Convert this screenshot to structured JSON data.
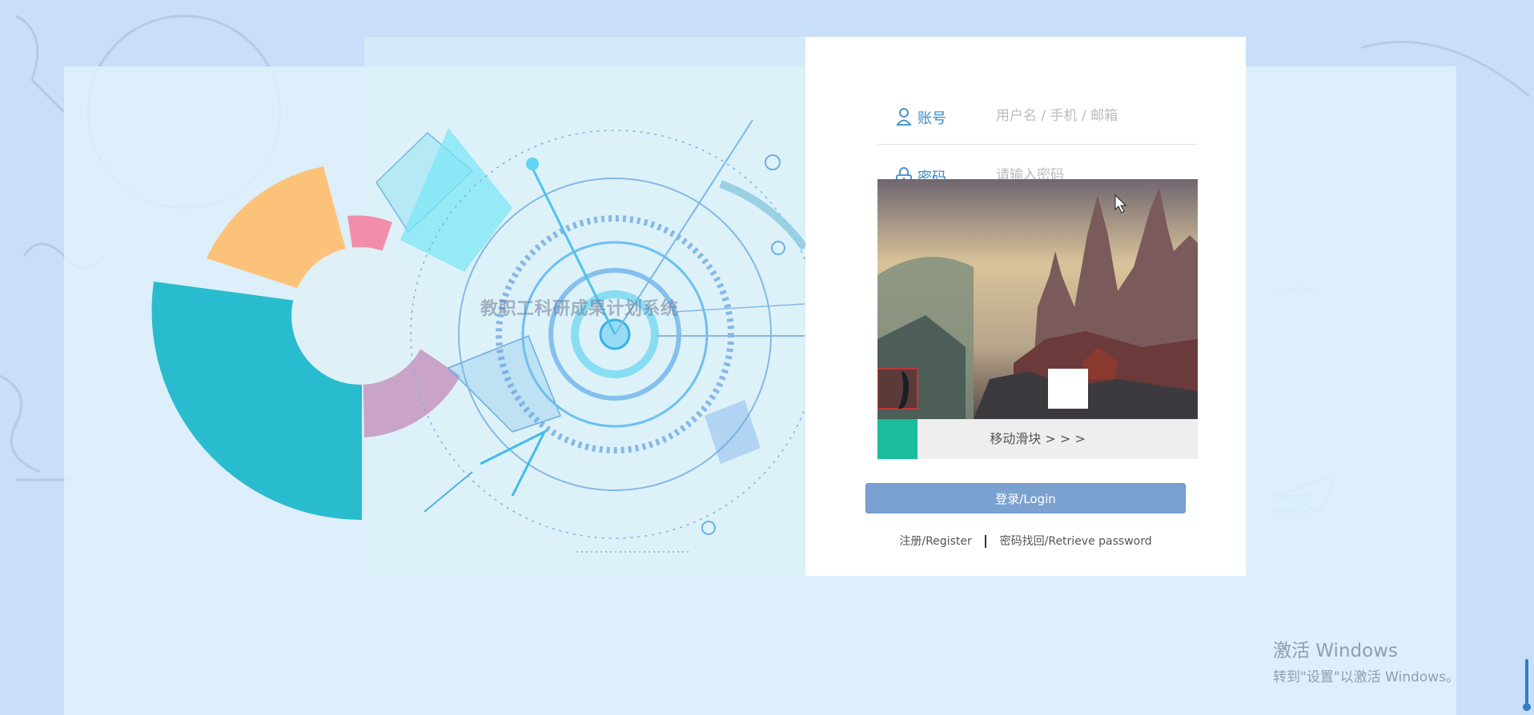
{
  "app": {
    "title": "教职工科研成果计划系统"
  },
  "login": {
    "account_label": "账号",
    "account_placeholder": "用户名 / 手机 / 邮箱",
    "password_label": "密码",
    "password_placeholder": "请输入密码",
    "slider_text": "移动滑块 > > >",
    "login_button": "登录/Login",
    "register_link": "注册/Register",
    "retrieve_link": "密码找回/Retrieve password"
  },
  "watermark": {
    "line1": "激活 Windows",
    "line2": "转到\"设置\"以激活 Windows。"
  },
  "colors": {
    "page_bg": "#c9def8",
    "label_blue": "#3a8bc4",
    "slider_green": "#1abc9c",
    "login_button": "#7aa1d0",
    "card_bg": "#ffffff"
  },
  "icons": [
    "user-icon",
    "lock-icon",
    "cursor-icon"
  ]
}
